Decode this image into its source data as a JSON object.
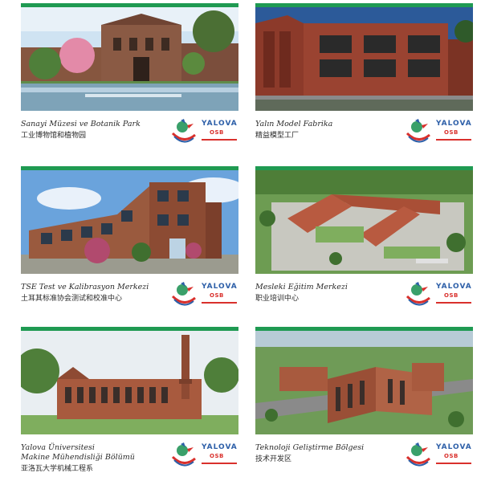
{
  "colors": {
    "accent_green": "#1f9a52",
    "brand_blue": "#2d5fa8",
    "brand_red": "#d9302c"
  },
  "logo": {
    "name": "YALOVA",
    "sub": "OSB",
    "icon": "yalova-osb-logo-icon"
  },
  "cards": [
    {
      "title": "Sanayi Müzesi ve Botanik Park",
      "title_line2": "",
      "subtitle": "工业博物馆和植物园",
      "image": "industrial-museum-botanical-park-photo"
    },
    {
      "title": "Yalın Model Fabrika",
      "title_line2": "",
      "subtitle": "精益模型工厂",
      "image": "lean-model-factory-photo"
    },
    {
      "title": "TSE Test ve Kalibrasyon Merkezi",
      "title_line2": "",
      "subtitle": "土耳其标准协会测试和校准中心",
      "image": "tse-test-calibration-center-photo"
    },
    {
      "title": "Mesleki Eğitim Merkezi",
      "title_line2": "",
      "subtitle": "职业培训中心",
      "image": "vocational-training-center-photo"
    },
    {
      "title": "Yalova Üniversitesi",
      "title_line2": "Makine Mühendisliği Bölümü",
      "subtitle": "亚洛瓦大学机械工程系",
      "image": "yalova-university-mechanical-engineering-photo"
    },
    {
      "title": "Teknoloji Geliştirme Bölgesi",
      "title_line2": "",
      "subtitle": "技术开发区",
      "image": "technology-development-zone-photo"
    }
  ]
}
